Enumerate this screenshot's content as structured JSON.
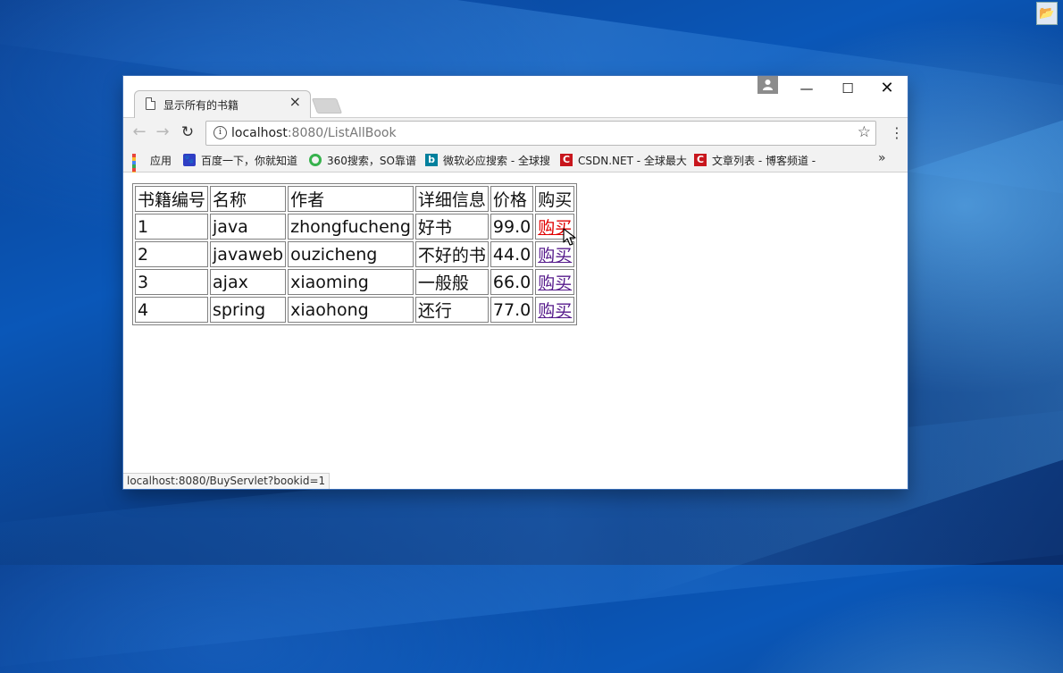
{
  "browser": {
    "tab_title": "显示所有的书籍",
    "tab_close": "×",
    "url_host": "localhost",
    "url_rest": ":8080/ListAllBook",
    "window_controls": {
      "minimize": "—",
      "maximize": "☐",
      "close": "✕"
    }
  },
  "bookmarks": [
    {
      "label": "应用",
      "icon": "apps-icon"
    },
    {
      "label": "百度一下，你就知道",
      "icon": "baidu-icon"
    },
    {
      "label": "360搜索，SO靠谱",
      "icon": "360-search-icon"
    },
    {
      "label": "微软必应搜索 - 全球搜",
      "icon": "bing-icon"
    },
    {
      "label": "CSDN.NET - 全球最大",
      "icon": "csdn-icon"
    },
    {
      "label": "文章列表 - 博客频道 -",
      "icon": "csdn-icon"
    }
  ],
  "bookmarks_more": "»",
  "table": {
    "headers": [
      "书籍编号",
      "名称",
      "作者",
      "详细信息",
      "价格",
      "购买"
    ],
    "rows": [
      {
        "id": "1",
        "name": "java",
        "author": "zhongfucheng",
        "detail": "好书",
        "price": "99.0",
        "buy": "购买"
      },
      {
        "id": "2",
        "name": "javaweb",
        "author": "ouzicheng",
        "detail": "不好的书",
        "price": "44.0",
        "buy": "购买"
      },
      {
        "id": "3",
        "name": "ajax",
        "author": "xiaoming",
        "detail": "一般般",
        "price": "66.0",
        "buy": "购买"
      },
      {
        "id": "4",
        "name": "spring",
        "author": "xiaohong",
        "detail": "还行",
        "price": "77.0",
        "buy": "购买"
      }
    ]
  },
  "status_bar": "localhost:8080/BuyServlet?bookid=1"
}
